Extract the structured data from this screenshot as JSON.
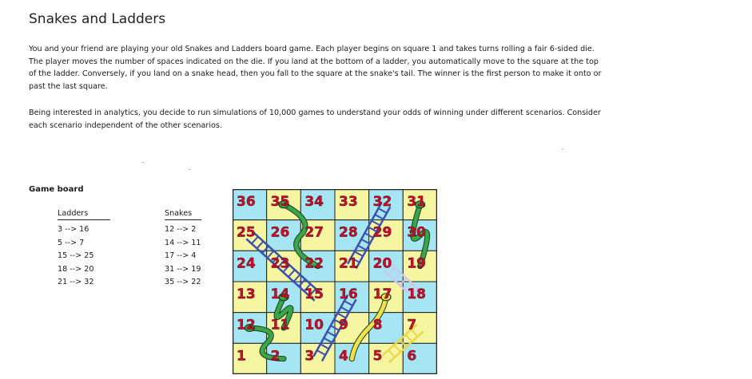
{
  "page": {
    "title": "Snakes and Ladders",
    "paragraph1": "You and your friend are playing your old Snakes and Ladders board game. Each player begins on square 1 and takes turns rolling a fair 6-sided die. The player moves the number of spaces indicated on the die. If you land at the bottom of a ladder, you automatically move to the square at the top of the ladder. Conversely, if you land on a snake head, then you fall to the square at the snake's tail. The winner is the first person to make it onto or past the last square.",
    "paragraph2": "Being interested in analytics, you decide to run simulations of 10,000 games to understand your odds of winning under different scenarios. Consider each scenario independent of the other scenarios.",
    "board_heading": "Game board"
  },
  "ladders": {
    "header": "Ladders",
    "items": [
      "3 --> 16",
      "5 --> 7",
      "15 --> 25",
      "18 --> 20",
      "21 --> 32"
    ]
  },
  "snakes": {
    "header": "Snakes",
    "items": [
      "12 --> 2",
      "14 --> 11",
      "17 --> 4",
      "31 --> 19",
      "35 --> 22"
    ]
  },
  "board": {
    "rows": [
      [
        "36",
        "35",
        "34",
        "33",
        "32",
        "31"
      ],
      [
        "25",
        "26",
        "27",
        "28",
        "29",
        "30"
      ],
      [
        "24",
        "23",
        "22",
        "21",
        "20",
        "19"
      ],
      [
        "13",
        "14",
        "15",
        "16",
        "17",
        "18"
      ],
      [
        "12",
        "11",
        "10",
        "9",
        "8",
        "7"
      ],
      [
        "1",
        "2",
        "3",
        "4",
        "5",
        "6"
      ]
    ],
    "colors": {
      "cyan": "#a6e6f4",
      "yellow": "#f6f5a2",
      "number": "#c8102e",
      "ladder": "#3b4fb0",
      "snake_green": "#3aa64c",
      "snake_yellow": "#f0e24a"
    }
  }
}
